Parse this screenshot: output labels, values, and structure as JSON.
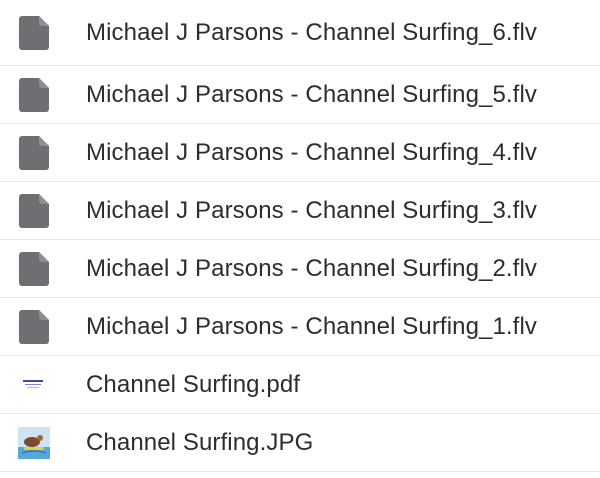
{
  "files": [
    {
      "name": "Michael J Parsons - Channel Surfing_6.flv",
      "icon": "generic-file-icon"
    },
    {
      "name": "Michael J Parsons - Channel Surfing_5.flv",
      "icon": "generic-file-icon"
    },
    {
      "name": "Michael J Parsons - Channel Surfing_4.flv",
      "icon": "generic-file-icon"
    },
    {
      "name": "Michael J Parsons - Channel Surfing_3.flv",
      "icon": "generic-file-icon"
    },
    {
      "name": "Michael J Parsons - Channel Surfing_2.flv",
      "icon": "generic-file-icon"
    },
    {
      "name": "Michael J Parsons - Channel Surfing_1.flv",
      "icon": "generic-file-icon"
    },
    {
      "name": "Channel Surfing.pdf",
      "icon": "pdf-thumbnail-icon"
    },
    {
      "name": "Channel Surfing.JPG",
      "icon": "image-thumbnail-icon"
    }
  ],
  "colors": {
    "file_icon": "#6e6e73",
    "divider": "#e8e8e8",
    "text": "#2d2d2d"
  }
}
